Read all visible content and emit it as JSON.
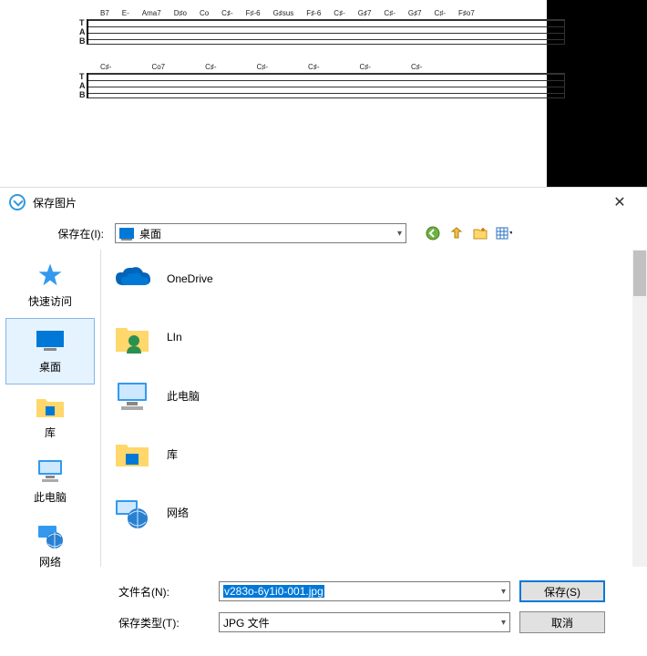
{
  "dialog": {
    "title": "保存图片",
    "save_in_label": "保存在(I):",
    "location": "桌面",
    "filename_label": "文件名(N):",
    "filename_value": "v283o-6y1i0-001.jpg",
    "filetype_label": "保存类型(T):",
    "filetype_value": "JPG 文件",
    "save_button": "保存(S)",
    "cancel_button": "取消"
  },
  "sidebar": {
    "items": [
      {
        "label": "快速访问"
      },
      {
        "label": "桌面"
      },
      {
        "label": "库"
      },
      {
        "label": "此电脑"
      },
      {
        "label": "网络"
      }
    ]
  },
  "files": {
    "items": [
      {
        "label": "OneDrive"
      },
      {
        "label": "LIn"
      },
      {
        "label": "此电脑"
      },
      {
        "label": "库"
      },
      {
        "label": "网络"
      }
    ]
  },
  "tab": {
    "row1": [
      "B7",
      "E-",
      "Ama7",
      "D♯o",
      "Co",
      "C♯-",
      "F♯-6",
      "G♯sus",
      "F♯-6",
      "C♯-",
      "G♯7",
      "C♯-",
      "G♯7",
      "C♯-",
      "F♯o7"
    ],
    "row2": [
      "C♯-",
      "Co7",
      "C♯-",
      "C♯-",
      "C♯-",
      "C♯-",
      "C♯-"
    ]
  }
}
